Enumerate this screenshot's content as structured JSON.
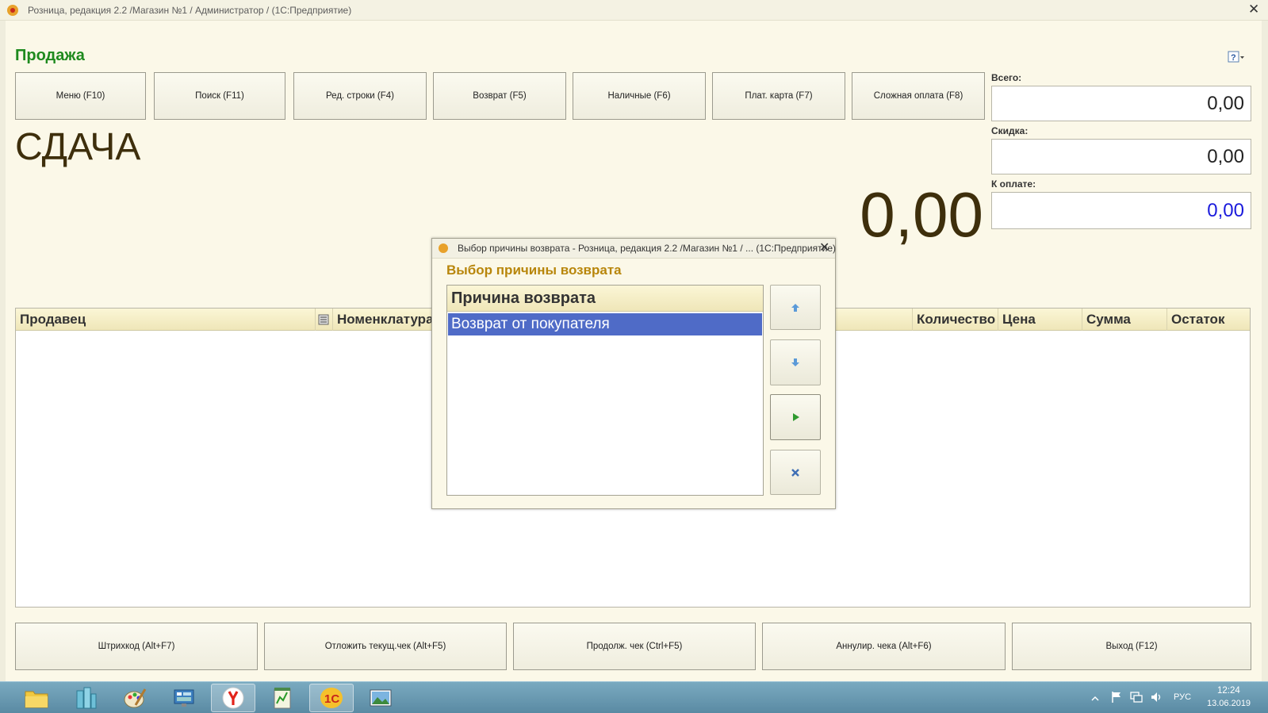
{
  "window": {
    "title": "Розница, редакция 2.2 /Магазин №1 / Администратор /  (1С:Предприятие)",
    "close": "✕"
  },
  "form": {
    "title": "Продажа",
    "help_icon": "help-icon"
  },
  "toolbar": {
    "buttons": [
      "Меню (F10)",
      "Поиск (F11)",
      "Ред. строки (F4)",
      "Возврат (F5)",
      "Наличные (F6)",
      "Плат. карта (F7)",
      "Сложная оплата (F8)"
    ]
  },
  "totals": {
    "total_label": "Всего:",
    "total_value": "0,00",
    "discount_label": "Скидка:",
    "discount_value": "0,00",
    "to_pay_label": "К оплате:",
    "to_pay_value": "0,00",
    "to_pay_color": "#1a1adc"
  },
  "change": {
    "label": "СДАЧА",
    "value": "0,00"
  },
  "table": {
    "columns": [
      "Продавец",
      "Номенклатура",
      "Количество",
      "Цена",
      "Сумма",
      "Остаток"
    ],
    "rows": []
  },
  "modal": {
    "title": "Выбор причины возврата - Розница, редакция 2.2 /Магазин №1 / ...  (1С:Предприятие)",
    "close": "✕",
    "heading": "Выбор причины возврата",
    "list_header": "Причина возврата",
    "selected_row": "Возврат от покупателя",
    "buttons": [
      "move-up-icon",
      "move-down-icon",
      "select-icon",
      "cancel-icon"
    ]
  },
  "bottom": {
    "buttons": [
      "Штрихкод (Alt+F7)",
      "Отложить текущ.чек (Alt+F5)",
      "Продолж. чек (Ctrl+F5)",
      "Аннулир. чека (Alt+F6)",
      "Выход (F12)"
    ]
  },
  "taskbar": {
    "icons": [
      "folder-icon",
      "buildings-icon",
      "paint-icon",
      "control-panel-icon",
      "yandex-browser-icon",
      "notepad-icon",
      "1c-icon",
      "picture-viewer-icon"
    ],
    "language": "РУС",
    "time": "12:24",
    "date": "13.06.2019"
  },
  "colors": {
    "accent_green": "#1e8a1e",
    "selection_blue": "#4f6bc7",
    "modal_heading": "#b8860b"
  }
}
